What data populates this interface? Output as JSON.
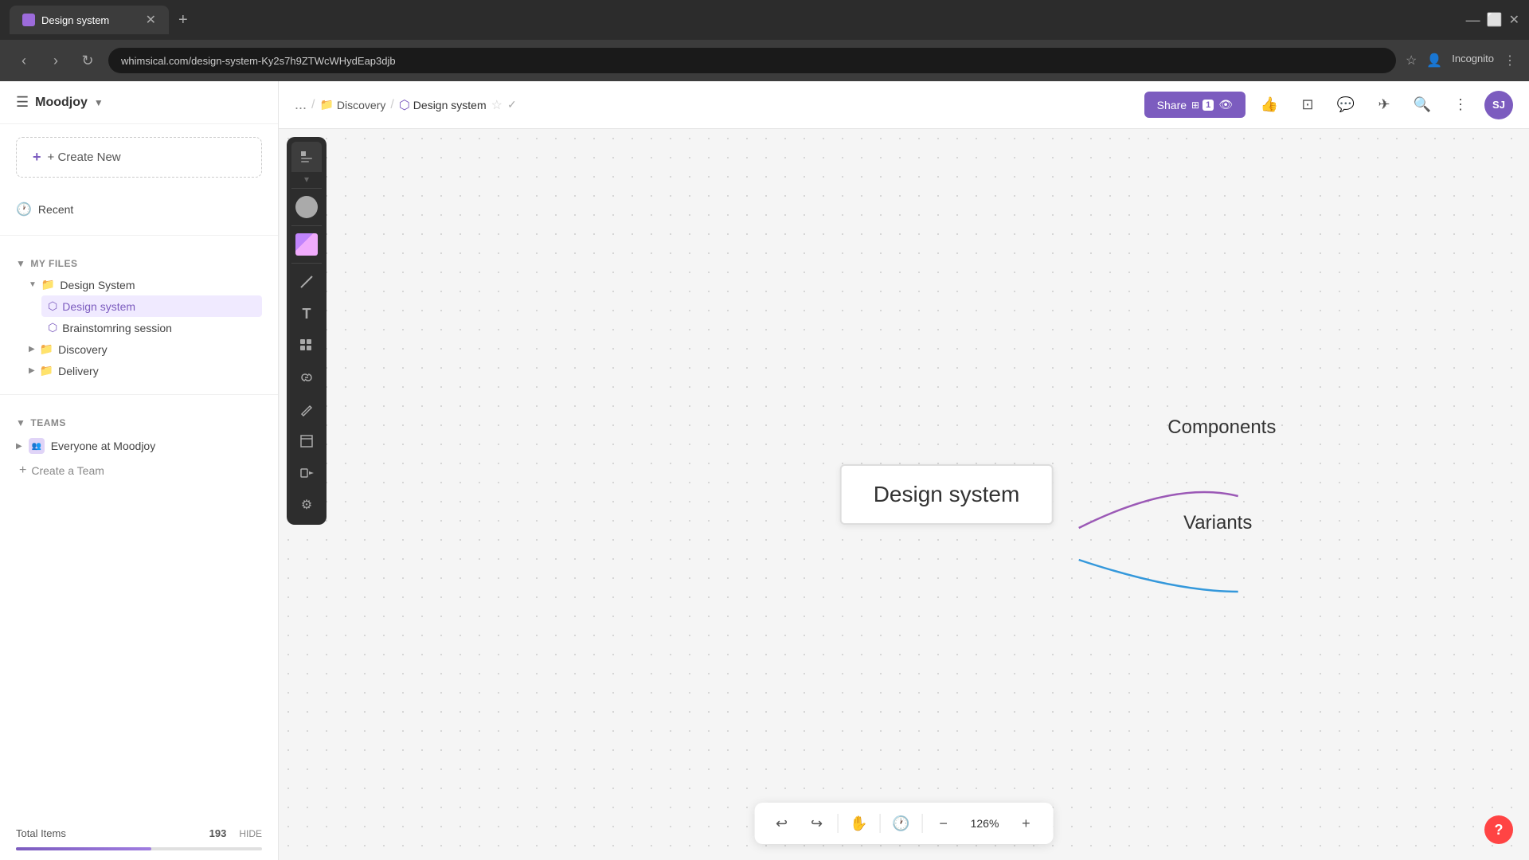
{
  "browser": {
    "tab_title": "Design system",
    "url": "whimsical.com/design-system-Ky2s7h9ZTWcWHydEap3djb",
    "incognito_label": "Incognito"
  },
  "sidebar": {
    "workspace_name": "Moodjoy",
    "create_new_label": "+ Create New",
    "recent_label": "Recent",
    "my_files_label": "MY FILES",
    "design_system_folder": "Design System",
    "design_system_file": "Design system",
    "brainstorming_file": "Brainstomring session",
    "discovery_folder": "Discovery",
    "delivery_folder": "Delivery",
    "teams_label": "TEAMS",
    "everyone_team": "Everyone at Moodjoy",
    "create_team_label": "Create a Team",
    "total_items_label": "Total Items",
    "total_items_count": "193",
    "hide_label": "HIDE"
  },
  "topbar": {
    "breadcrumb_dots": "...",
    "breadcrumb_folder": "Discovery",
    "breadcrumb_file": "Design system",
    "share_label": "Share",
    "share_count": "1"
  },
  "canvas": {
    "central_node_text": "Design system",
    "components_label": "Components",
    "variants_label": "Variants"
  },
  "bottom_toolbar": {
    "zoom_level": "126%"
  },
  "user_avatar": "SJ"
}
